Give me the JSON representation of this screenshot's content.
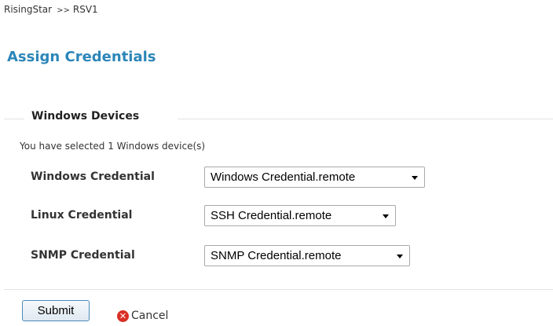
{
  "breadcrumb": {
    "root": "RisingStar",
    "separator": ">>",
    "current": "RSV1"
  },
  "page": {
    "title": "Assign Credentials"
  },
  "windows_devices": {
    "legend": "Windows Devices",
    "selection_note": "You have selected 1 Windows device(s)",
    "fields": [
      {
        "label": "Windows Credential",
        "value": "Windows Credential.remote"
      },
      {
        "label": "Linux Credential",
        "value": "SSH Credential.remote"
      },
      {
        "label": "SNMP Credential",
        "value": "SNMP Credential.remote"
      }
    ]
  },
  "actions": {
    "submit_label": "Submit",
    "cancel_label": "Cancel",
    "cancel_icon": "cancel-x-icon"
  },
  "colors": {
    "title": "#2c86b8",
    "cancel_icon": "#d93025"
  }
}
